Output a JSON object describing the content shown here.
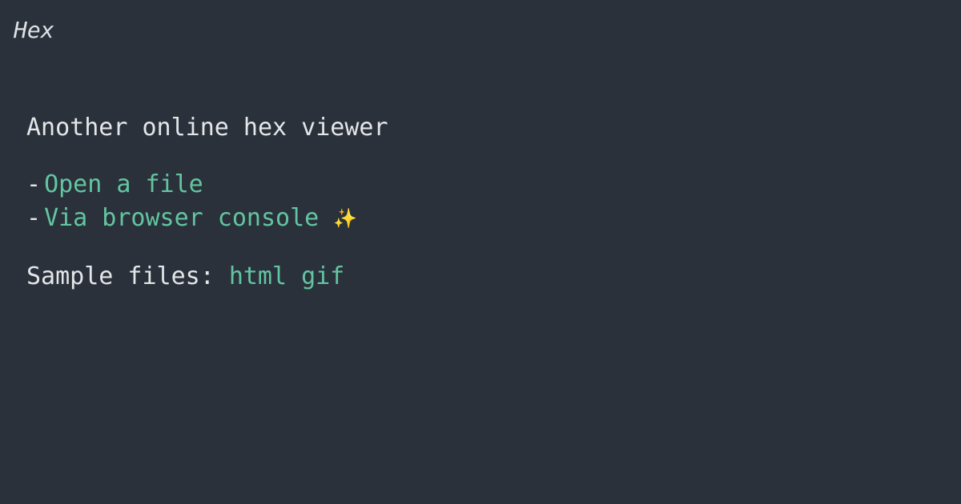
{
  "header": {
    "logo_text": "Hex"
  },
  "main": {
    "tagline": "Another online hex viewer",
    "options": [
      {
        "bullet": "-",
        "label": "Open a file"
      },
      {
        "bullet": "-",
        "label": "Via browser console",
        "emoji": "✨"
      }
    ],
    "samples": {
      "label": "Sample files:",
      "links": [
        "html",
        "gif"
      ]
    }
  },
  "colors": {
    "background": "#2a313b",
    "text": "#e4e6e8",
    "accent": "#63c5a0",
    "sparkle": "#f3c14a"
  }
}
